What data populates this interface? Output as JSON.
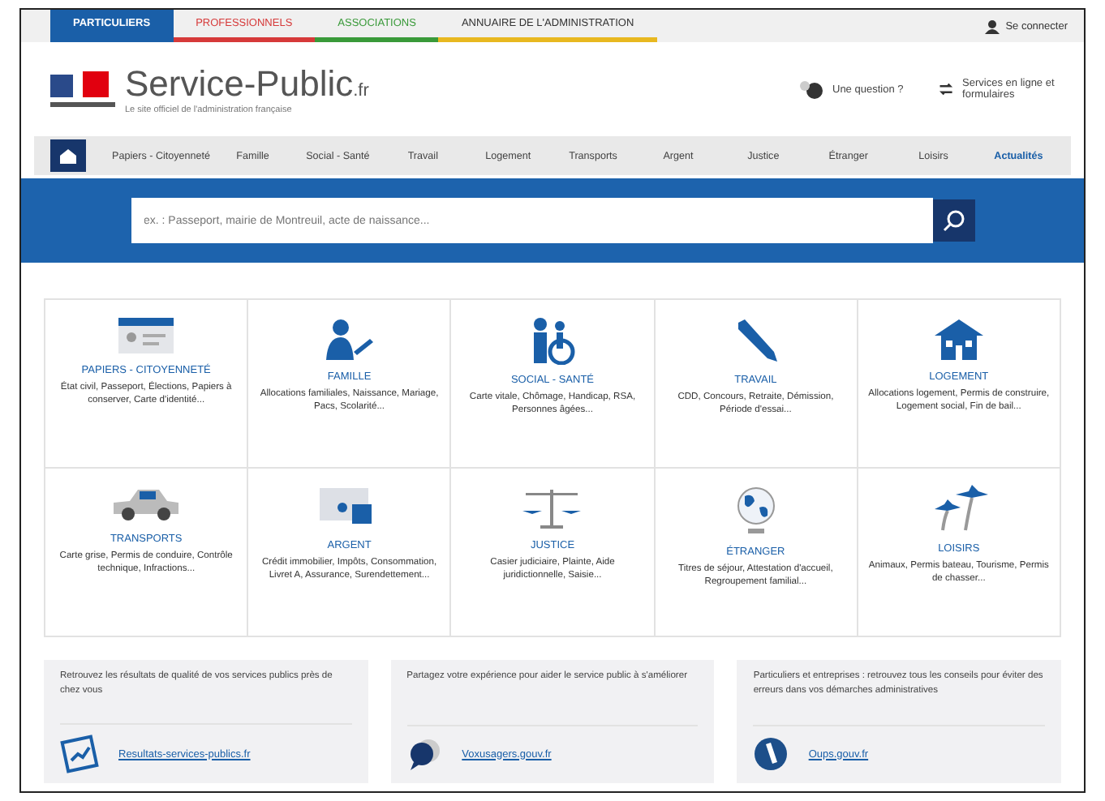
{
  "audience_tabs": [
    {
      "label": "PARTICULIERS",
      "selected": true,
      "color": "#1a5fa8"
    },
    {
      "label": "PROFESSIONNELS",
      "selected": false,
      "color": "#d63a3a"
    },
    {
      "label": "ASSOCIATIONS",
      "selected": false,
      "color": "#3a9a3a"
    },
    {
      "label": "ANNUAIRE DE L'ADMINISTRATION",
      "selected": false,
      "color": "#e8b820"
    }
  ],
  "login": "Se connecter",
  "logo": {
    "name": "Service-Public",
    "suffix": ".fr",
    "tagline": "Le site officiel de l'administration française"
  },
  "header_links": [
    "Une question ?",
    "Services en ligne et formulaires"
  ],
  "nav": [
    {
      "label": "Papiers - Citoyenneté",
      "selected": false
    },
    {
      "label": "Famille",
      "selected": false
    },
    {
      "label": "Social - Santé",
      "selected": false
    },
    {
      "label": "Travail",
      "selected": false
    },
    {
      "label": "Logement",
      "selected": false
    },
    {
      "label": "Transports",
      "selected": false
    },
    {
      "label": "Argent",
      "selected": false
    },
    {
      "label": "Justice",
      "selected": false
    },
    {
      "label": "Étranger",
      "selected": false
    },
    {
      "label": "Loisirs",
      "selected": false
    },
    {
      "label": "Actualités",
      "selected": true
    }
  ],
  "search": {
    "placeholder": "ex. : Passeport, mairie de Montreuil, acte de naissance..."
  },
  "categories": [
    {
      "title": "PAPIERS - CITOYENNETÉ",
      "text": "État civil, Passeport, Élections, Papiers à conserver, Carte d'identité..."
    },
    {
      "title": "FAMILLE",
      "text": "Allocations familiales, Naissance, Mariage, Pacs, Scolarité..."
    },
    {
      "title": "SOCIAL - SANTÉ",
      "text": "Carte vitale, Chômage, Handicap, RSA, Personnes âgées..."
    },
    {
      "title": "TRAVAIL",
      "text": "CDD, Concours, Retraite, Démission, Période d'essai..."
    },
    {
      "title": "LOGEMENT",
      "text": "Allocations logement, Permis de construire, Logement social, Fin de bail..."
    },
    {
      "title": "TRANSPORTS",
      "text": "Carte grise, Permis de conduire, Contrôle technique, Infractions..."
    },
    {
      "title": "ARGENT",
      "text": "Crédit immobilier, Impôts, Consommation, Livret A, Assurance, Surendettement..."
    },
    {
      "title": "JUSTICE",
      "text": "Casier judiciaire, Plainte, Aide juridictionnelle, Saisie..."
    },
    {
      "title": "ÉTRANGER",
      "text": "Titres de séjour, Attestation d'accueil, Regroupement familial..."
    },
    {
      "title": "LOISIRS",
      "text": "Animaux, Permis bateau, Tourisme, Permis de chasser..."
    }
  ],
  "promo_cards": [
    {
      "text": "Retrouvez les résultats de qualité de vos services publics près de chez vous",
      "link": "Resultats-services-publics.fr"
    },
    {
      "text": "Partagez votre expérience pour aider le service public à s'améliorer",
      "link": "Voxusagers.gouv.fr"
    },
    {
      "text": "Particuliers et entreprises : retrouvez tous les conseils pour éviter des erreurs dans vos démarches administratives",
      "link": "Oups.gouv.fr"
    }
  ]
}
